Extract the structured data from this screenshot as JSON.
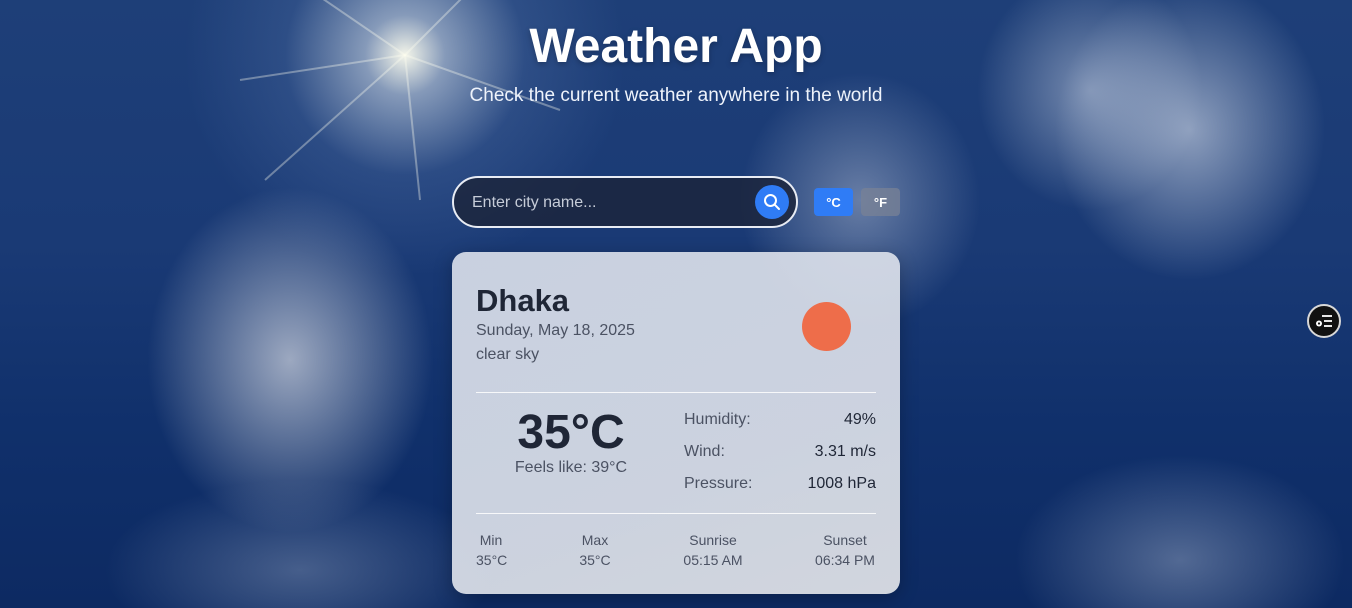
{
  "app": {
    "title": "Weather App",
    "subtitle": "Check the current weather anywhere in the world"
  },
  "search": {
    "placeholder": "Enter city name...",
    "value": "",
    "button_icon": "search-icon"
  },
  "units": {
    "celsius_label": "°C",
    "fahrenheit_label": "°F",
    "selected": "celsius"
  },
  "weather": {
    "city": "Dhaka",
    "date": "Sunday, May 18, 2025",
    "condition": "clear sky",
    "icon": "sun-icon",
    "temperature": "35°C",
    "feels_like": "Feels like: 39°C",
    "details": [
      {
        "label": "Humidity:",
        "value": "49%"
      },
      {
        "label": "Wind:",
        "value": "3.31 m/s"
      },
      {
        "label": "Pressure:",
        "value": "1008 hPa"
      }
    ],
    "stats": [
      {
        "label": "Min",
        "value": "35°C"
      },
      {
        "label": "Max",
        "value": "35°C"
      },
      {
        "label": "Sunrise",
        "value": "05:15 AM"
      },
      {
        "label": "Sunset",
        "value": "06:34 PM"
      }
    ]
  },
  "floating_action": {
    "icon": "settings-list-icon"
  },
  "colors": {
    "accent": "#2f7cf6",
    "sun": "#ee6d4a",
    "text_dark": "#1f2636"
  }
}
